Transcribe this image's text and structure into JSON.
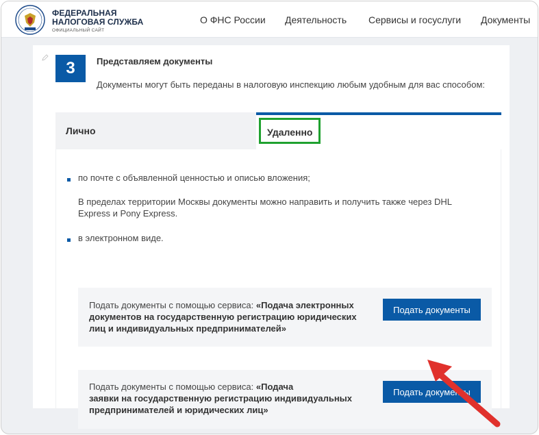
{
  "header": {
    "brand_line1": "ФЕДЕРАЛЬНАЯ",
    "brand_line2": "НАЛОГОВАЯ СЛУЖБА",
    "brand_line3": "ОФИЦИАЛЬНЫЙ САЙТ",
    "nav": [
      "О ФНС России",
      "Деятельность",
      "Сервисы и госуслуги",
      "Документы"
    ]
  },
  "step": {
    "number": "3",
    "title": "Представляем документы",
    "subtitle": "Документы могут быть переданы в налоговую инспекцию любым удобным для вас способом:"
  },
  "tabs": {
    "lichno": "Лично",
    "udalenno": "Удаленно"
  },
  "panel": {
    "bullet1": "по почте с объявленной ценностью и описью вложения;",
    "note_line1": "В пределах территории Москвы документы можно направить и получить также через DHL",
    "note_line2": "Express и Pony Express.",
    "bullet2": "в электронном виде.",
    "service1": {
      "prefix": "Подать документы с помощью сервиса: ",
      "bold_line1": "«Подача электронных",
      "line2": "документов на государственную регистрацию юридических",
      "line3": "лиц и индивидуальных предпринимателей»",
      "button": "Подать документы"
    },
    "service2": {
      "prefix": "Подать документы с помощью сервиса: ",
      "bold_line1": "«Подача",
      "line2": "заявки на государственную регистрацию индивидуальных",
      "line3": "предпринимателей и юридических лиц»",
      "button": "Подать документы"
    }
  },
  "colors": {
    "accent": "#0a5aa6",
    "highlight": "#1fa12f",
    "arrow": "#e0312c"
  }
}
